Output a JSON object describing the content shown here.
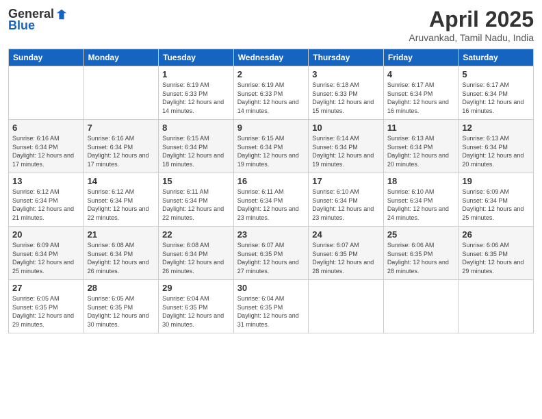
{
  "header": {
    "logo_general": "General",
    "logo_blue": "Blue",
    "title": "April 2025",
    "subtitle": "Aruvankad, Tamil Nadu, India"
  },
  "days_of_week": [
    "Sunday",
    "Monday",
    "Tuesday",
    "Wednesday",
    "Thursday",
    "Friday",
    "Saturday"
  ],
  "weeks": [
    [
      {
        "day": "",
        "info": ""
      },
      {
        "day": "",
        "info": ""
      },
      {
        "day": "1",
        "info": "Sunrise: 6:19 AM\nSunset: 6:33 PM\nDaylight: 12 hours and 14 minutes."
      },
      {
        "day": "2",
        "info": "Sunrise: 6:19 AM\nSunset: 6:33 PM\nDaylight: 12 hours and 14 minutes."
      },
      {
        "day": "3",
        "info": "Sunrise: 6:18 AM\nSunset: 6:33 PM\nDaylight: 12 hours and 15 minutes."
      },
      {
        "day": "4",
        "info": "Sunrise: 6:17 AM\nSunset: 6:34 PM\nDaylight: 12 hours and 16 minutes."
      },
      {
        "day": "5",
        "info": "Sunrise: 6:17 AM\nSunset: 6:34 PM\nDaylight: 12 hours and 16 minutes."
      }
    ],
    [
      {
        "day": "6",
        "info": "Sunrise: 6:16 AM\nSunset: 6:34 PM\nDaylight: 12 hours and 17 minutes."
      },
      {
        "day": "7",
        "info": "Sunrise: 6:16 AM\nSunset: 6:34 PM\nDaylight: 12 hours and 17 minutes."
      },
      {
        "day": "8",
        "info": "Sunrise: 6:15 AM\nSunset: 6:34 PM\nDaylight: 12 hours and 18 minutes."
      },
      {
        "day": "9",
        "info": "Sunrise: 6:15 AM\nSunset: 6:34 PM\nDaylight: 12 hours and 19 minutes."
      },
      {
        "day": "10",
        "info": "Sunrise: 6:14 AM\nSunset: 6:34 PM\nDaylight: 12 hours and 19 minutes."
      },
      {
        "day": "11",
        "info": "Sunrise: 6:13 AM\nSunset: 6:34 PM\nDaylight: 12 hours and 20 minutes."
      },
      {
        "day": "12",
        "info": "Sunrise: 6:13 AM\nSunset: 6:34 PM\nDaylight: 12 hours and 20 minutes."
      }
    ],
    [
      {
        "day": "13",
        "info": "Sunrise: 6:12 AM\nSunset: 6:34 PM\nDaylight: 12 hours and 21 minutes."
      },
      {
        "day": "14",
        "info": "Sunrise: 6:12 AM\nSunset: 6:34 PM\nDaylight: 12 hours and 22 minutes."
      },
      {
        "day": "15",
        "info": "Sunrise: 6:11 AM\nSunset: 6:34 PM\nDaylight: 12 hours and 22 minutes."
      },
      {
        "day": "16",
        "info": "Sunrise: 6:11 AM\nSunset: 6:34 PM\nDaylight: 12 hours and 23 minutes."
      },
      {
        "day": "17",
        "info": "Sunrise: 6:10 AM\nSunset: 6:34 PM\nDaylight: 12 hours and 23 minutes."
      },
      {
        "day": "18",
        "info": "Sunrise: 6:10 AM\nSunset: 6:34 PM\nDaylight: 12 hours and 24 minutes."
      },
      {
        "day": "19",
        "info": "Sunrise: 6:09 AM\nSunset: 6:34 PM\nDaylight: 12 hours and 25 minutes."
      }
    ],
    [
      {
        "day": "20",
        "info": "Sunrise: 6:09 AM\nSunset: 6:34 PM\nDaylight: 12 hours and 25 minutes."
      },
      {
        "day": "21",
        "info": "Sunrise: 6:08 AM\nSunset: 6:34 PM\nDaylight: 12 hours and 26 minutes."
      },
      {
        "day": "22",
        "info": "Sunrise: 6:08 AM\nSunset: 6:34 PM\nDaylight: 12 hours and 26 minutes."
      },
      {
        "day": "23",
        "info": "Sunrise: 6:07 AM\nSunset: 6:35 PM\nDaylight: 12 hours and 27 minutes."
      },
      {
        "day": "24",
        "info": "Sunrise: 6:07 AM\nSunset: 6:35 PM\nDaylight: 12 hours and 28 minutes."
      },
      {
        "day": "25",
        "info": "Sunrise: 6:06 AM\nSunset: 6:35 PM\nDaylight: 12 hours and 28 minutes."
      },
      {
        "day": "26",
        "info": "Sunrise: 6:06 AM\nSunset: 6:35 PM\nDaylight: 12 hours and 29 minutes."
      }
    ],
    [
      {
        "day": "27",
        "info": "Sunrise: 6:05 AM\nSunset: 6:35 PM\nDaylight: 12 hours and 29 minutes."
      },
      {
        "day": "28",
        "info": "Sunrise: 6:05 AM\nSunset: 6:35 PM\nDaylight: 12 hours and 30 minutes."
      },
      {
        "day": "29",
        "info": "Sunrise: 6:04 AM\nSunset: 6:35 PM\nDaylight: 12 hours and 30 minutes."
      },
      {
        "day": "30",
        "info": "Sunrise: 6:04 AM\nSunset: 6:35 PM\nDaylight: 12 hours and 31 minutes."
      },
      {
        "day": "",
        "info": ""
      },
      {
        "day": "",
        "info": ""
      },
      {
        "day": "",
        "info": ""
      }
    ]
  ]
}
